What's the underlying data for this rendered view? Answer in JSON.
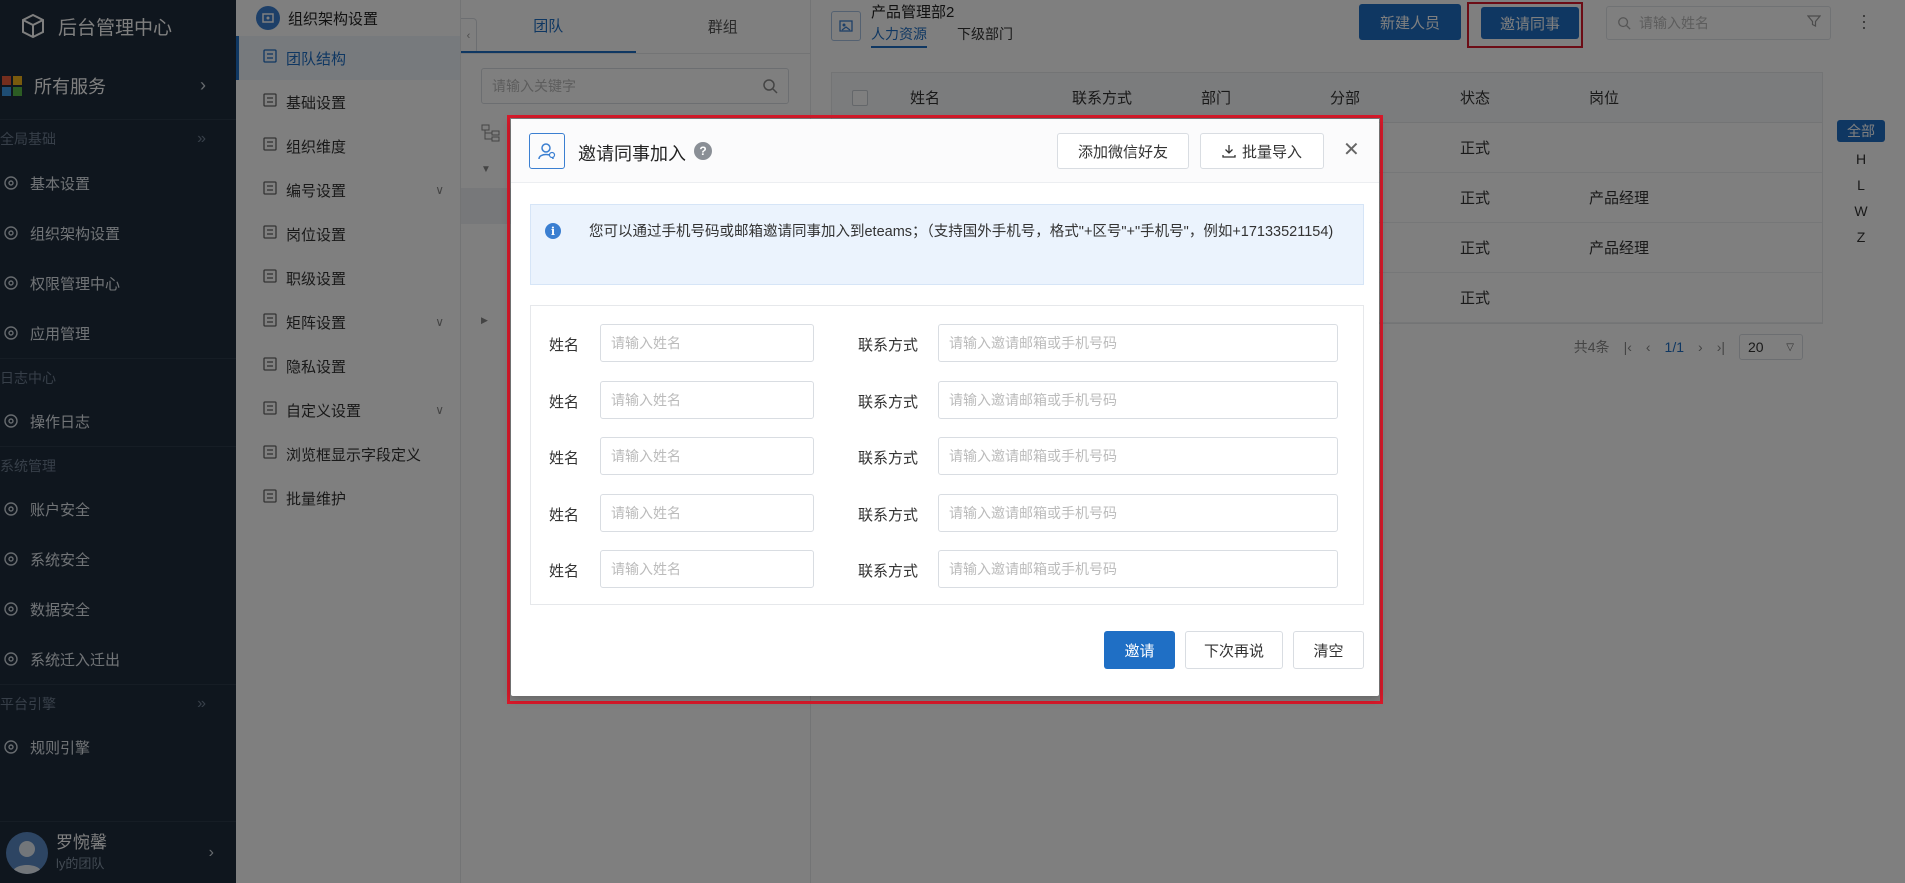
{
  "sidebar": {
    "app_title": "后台管理中心",
    "services_label": "所有服务",
    "groups": [
      {
        "label": "全局基础",
        "items": [
          "基本设置",
          "组织架构设置",
          "权限管理中心",
          "应用管理"
        ]
      },
      {
        "label": "日志中心",
        "items": [
          "操作日志"
        ]
      },
      {
        "label": "系统管理",
        "items": [
          "账户安全",
          "系统安全",
          "数据安全",
          "系统迁入迁出"
        ]
      },
      {
        "label": "平台引擎",
        "items": [
          "规则引擎"
        ]
      }
    ],
    "user": {
      "name": "罗惋馨",
      "team": "ly的团队"
    }
  },
  "subnav": {
    "title": "组织架构设置",
    "items": [
      {
        "label": "团队结构",
        "active": true,
        "expandable": false
      },
      {
        "label": "基础设置",
        "active": false,
        "expandable": false
      },
      {
        "label": "组织维度",
        "active": false,
        "expandable": false
      },
      {
        "label": "编号设置",
        "active": false,
        "expandable": true
      },
      {
        "label": "岗位设置",
        "active": false,
        "expandable": false
      },
      {
        "label": "职级设置",
        "active": false,
        "expandable": false
      },
      {
        "label": "矩阵设置",
        "active": false,
        "expandable": true
      },
      {
        "label": "隐私设置",
        "active": false,
        "expandable": false
      },
      {
        "label": "自定义设置",
        "active": false,
        "expandable": true
      },
      {
        "label": "浏览框显示字段定义",
        "active": false,
        "expandable": false
      },
      {
        "label": "批量维护",
        "active": false,
        "expandable": false
      }
    ]
  },
  "tree": {
    "tabs": [
      "团队",
      "群组"
    ],
    "search_placeholder": "请输入关键字"
  },
  "main": {
    "dept_title": "产品管理部2",
    "dept_tabs": [
      "人力资源",
      "下级部门"
    ],
    "new_person_label": "新建人员",
    "invite_label": "邀请同事",
    "search_placeholder": "请输入姓名",
    "columns": [
      "姓名",
      "联系方式",
      "部门",
      "分部",
      "状态",
      "岗位"
    ],
    "rows": [
      {
        "status": "正式",
        "post": ""
      },
      {
        "status": "正式",
        "post": "产品经理"
      },
      {
        "status": "正式",
        "post": "产品经理"
      },
      {
        "status": "正式",
        "post": ""
      }
    ],
    "pager": {
      "total": "共4条",
      "page": "1/1",
      "size": "20"
    },
    "alpha": [
      "全部",
      "H",
      "L",
      "W",
      "Z"
    ]
  },
  "modal": {
    "title": "邀请同事加入",
    "add_wechat_label": "添加微信好友",
    "batch_import_label": "批量导入",
    "notice": "您可以通过手机号码或邮箱邀请同事加入到eteams；（支持国外手机号，格式\"+区号\"+\"手机号\"，例如+17133521154)",
    "name_label": "姓名",
    "contact_label": "联系方式",
    "name_placeholder": "请输入姓名",
    "contact_placeholder": "请输入邀请邮箱或手机号码",
    "row_count": 5,
    "invite_label": "邀请",
    "later_label": "下次再说",
    "clear_label": "清空"
  }
}
